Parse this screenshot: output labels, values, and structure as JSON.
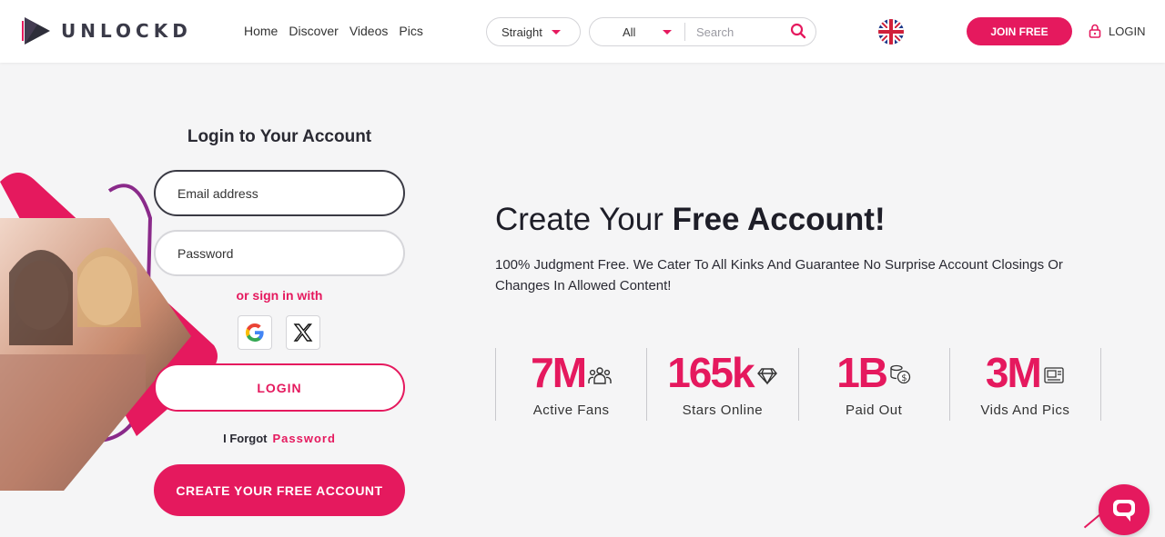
{
  "brand": {
    "name": "UNLOCKD",
    "accent": "#e5195e"
  },
  "nav": {
    "items": [
      "Home",
      "Discover",
      "Videos",
      "Pics"
    ]
  },
  "filters": {
    "orientation": "Straight",
    "category": "All",
    "search_placeholder": "Search"
  },
  "header": {
    "join_label": "JOIN FREE",
    "login_label": "LOGIN",
    "language_icon": "uk-flag-icon"
  },
  "login_form": {
    "title": "Login to Your Account",
    "email_placeholder": "Email address",
    "password_placeholder": "Password",
    "or_sign_in": "or sign in with",
    "login_button": "LOGIN",
    "forgot_prefix": "I Forgot",
    "forgot_link": "Password",
    "create_button": "CREATE YOUR FREE ACCOUNT"
  },
  "hero": {
    "title_regular": "Create Your ",
    "title_bold": "Free Account!",
    "subtitle": "100% Judgment Free. We Cater To All Kinks And Guarantee No Surprise Account Closings Or Changes In Allowed Content!"
  },
  "stats": [
    {
      "value": "7M",
      "label": "Active Fans",
      "icon": "people-icon"
    },
    {
      "value": "165k",
      "label": "Stars Online",
      "icon": "diamond-icon"
    },
    {
      "value": "1B",
      "label": "Paid Out",
      "icon": "coins-icon"
    },
    {
      "value": "3M",
      "label": "Vids And Pics",
      "icon": "media-icon"
    }
  ]
}
